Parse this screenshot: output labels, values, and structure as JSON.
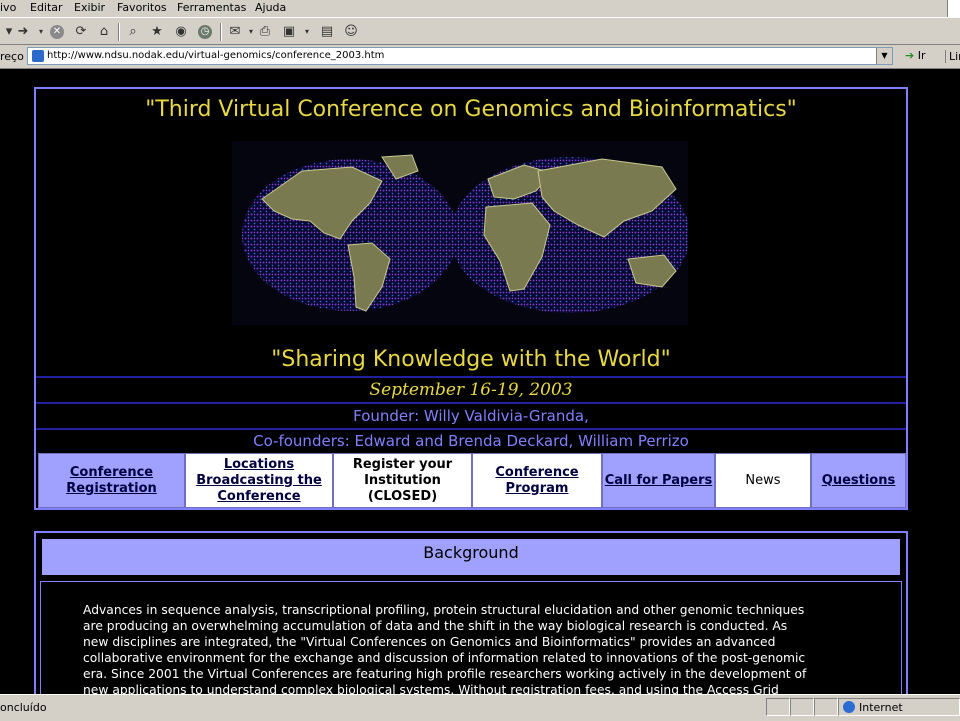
{
  "menu": {
    "items": [
      "ivo",
      "Editar",
      "Exibir",
      "Favoritos",
      "Ferramentas",
      "Ajuda"
    ]
  },
  "address": {
    "label": "reço",
    "url": "http://www.ndsu.nodak.edu/virtual-genomics/conference_2003.htm",
    "go_label": "Ir",
    "links_label": "Lin"
  },
  "page": {
    "title": "\"Third Virtual Conference on Genomics and Bioinformatics\"",
    "slogan": "\"Sharing Knowledge with the World\"",
    "dates": "September 16-19, 2003",
    "founder": "Founder: Willy Valdivia-Granda,",
    "cofounders": "Co-founders: Edward and Brenda Deckard, William Perrizo",
    "nav": {
      "registration": [
        "Conference",
        "Registration"
      ],
      "locations": [
        "Locations",
        "Broadcasting the",
        "Conference"
      ],
      "register_inst": [
        "Register your",
        "Institution",
        "(CLOSED)"
      ],
      "program": [
        "Conference",
        "Program"
      ],
      "call": "Call for Papers",
      "news": "News",
      "questions": "Questions"
    },
    "background": {
      "heading": "Background",
      "lines": [
        "Advances in sequence analysis, transcriptional profiling, protein structural elucidation and other genomic techniques",
        "are producing an overwhelming accumulation of data and the shift in the way biological research is conducted. As",
        "new disciplines are integrated, the \"Virtual Conferences on Genomics and Bioinformatics\" provides an advanced",
        "collaborative environment for the exchange and discussion of information related to innovations of the post-genomic",
        "era. Since 2001 the Virtual Conferences are featuring high profile researchers working actively in the development of",
        "new applications to understand complex biological systems. Without registration fees, and using the Access Grid"
      ]
    }
  },
  "status": {
    "text": "oncluído",
    "zone": "Internet"
  }
}
